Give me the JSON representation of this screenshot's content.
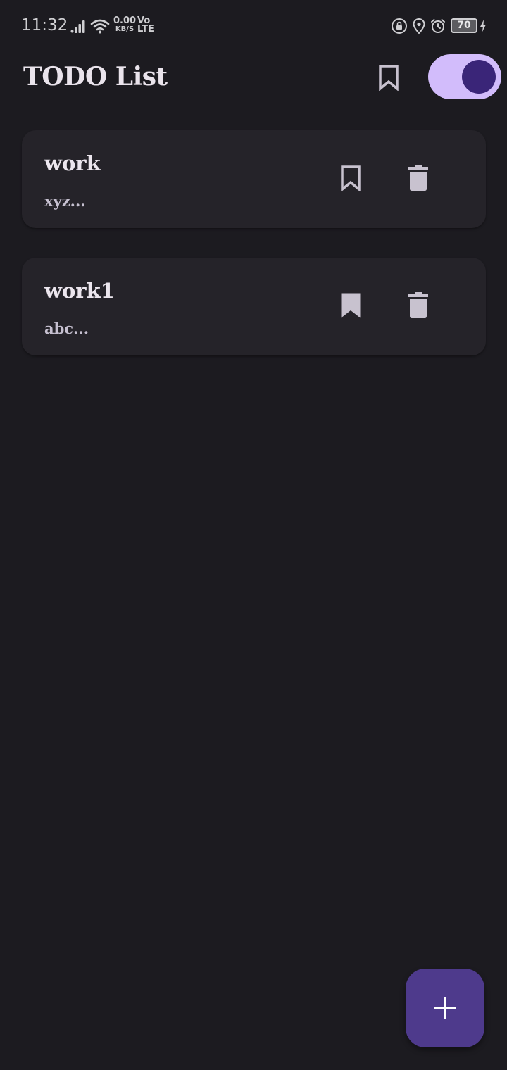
{
  "status_bar": {
    "time": "11:32",
    "net_speed_value": "0.00",
    "net_speed_unit": "KB/S",
    "volte_top": "Vo",
    "volte_bottom": "LTE",
    "battery": "70",
    "icons": [
      "signal-icon",
      "wifi-icon",
      "lock-rotation-icon",
      "location-icon",
      "alarm-icon",
      "battery-icon",
      "charging-icon"
    ]
  },
  "app_bar": {
    "title": "TODO List",
    "bookmarks_icon": "bookmark-outline-icon",
    "theme_toggle": {
      "state": "on",
      "track_color": "#d2bcfb",
      "thumb_color": "#3a2578"
    }
  },
  "tasks": [
    {
      "title": "work",
      "description": "xyz...",
      "bookmarked": false
    },
    {
      "title": "work1",
      "description": "abc...",
      "bookmarked": true
    }
  ],
  "fab": {
    "icon": "plus-icon",
    "color": "#4e3a8c"
  },
  "colors": {
    "background": "#1c1b20",
    "card": "#252329",
    "icon": "#c8c2cf"
  }
}
